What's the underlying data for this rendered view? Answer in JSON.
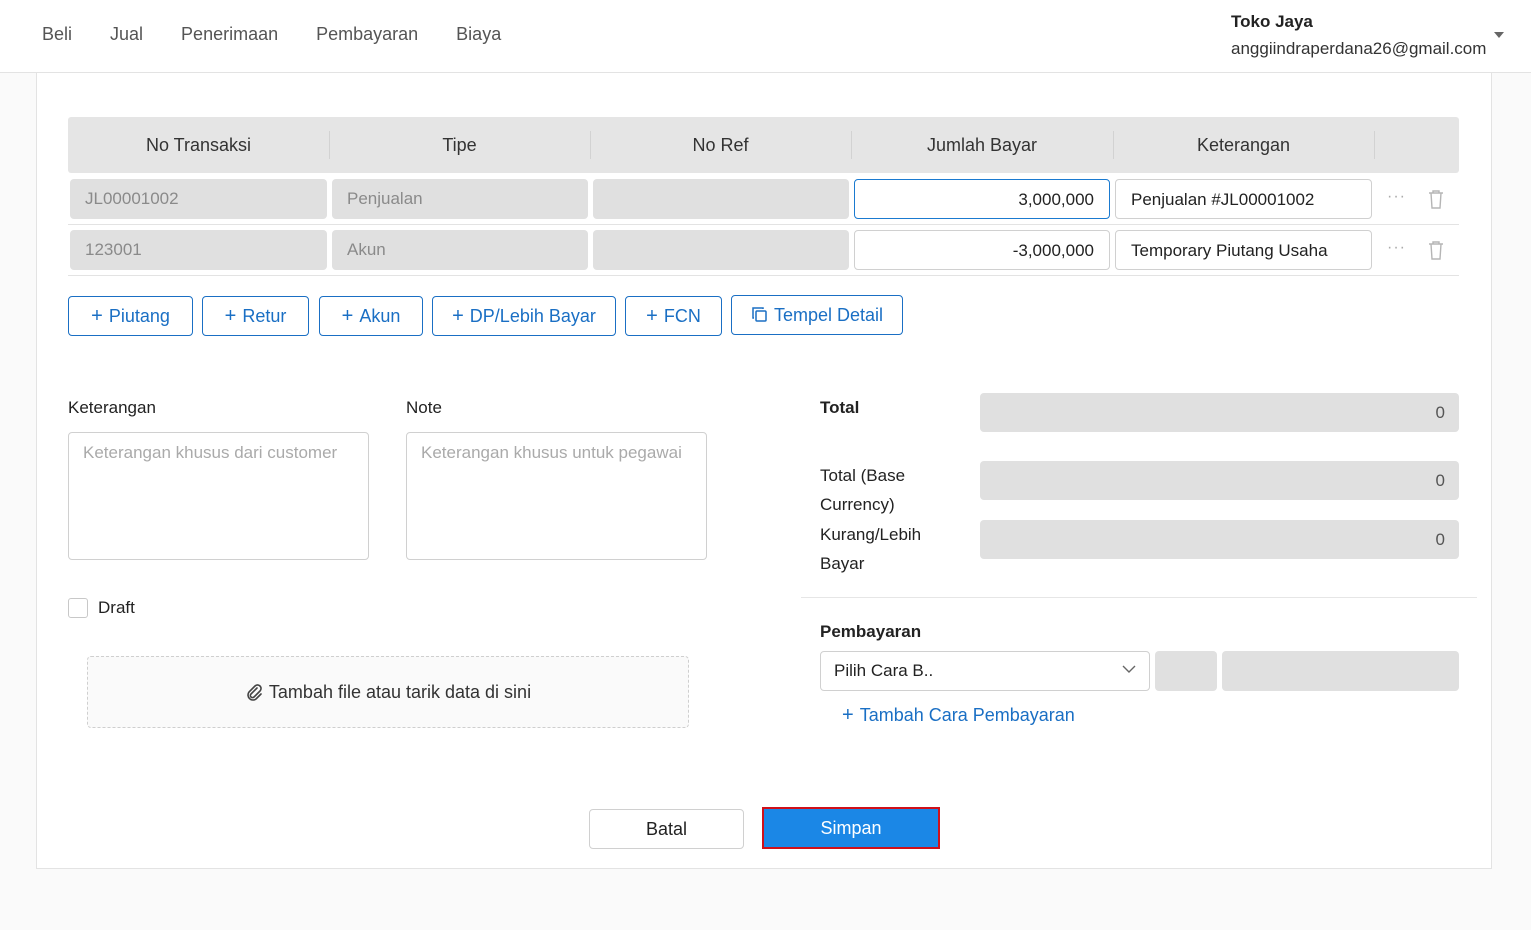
{
  "nav": [
    "Beli",
    "Jual",
    "Penerimaan",
    "Pembayaran",
    "Biaya"
  ],
  "user": {
    "company": "Toko Jaya",
    "email": "anggiindraperdana26@gmail.com"
  },
  "table": {
    "headers": [
      "No Transaksi",
      "Tipe",
      "No Ref",
      "Jumlah Bayar",
      "Keterangan"
    ],
    "rows": [
      {
        "no_transaksi": "JL00001002",
        "tipe": "Penjualan",
        "no_ref": "",
        "jumlah_bayar": "3,000,000",
        "keterangan": "Penjualan #JL00001002"
      },
      {
        "no_transaksi": "123001",
        "tipe": "Akun",
        "no_ref": "",
        "jumlah_bayar": "-3,000,000",
        "keterangan": "Temporary Piutang Usaha"
      }
    ]
  },
  "add_buttons": [
    "Piutang",
    "Retur",
    "Akun",
    "DP/Lebih Bayar",
    "FCN",
    "Tempel Detail"
  ],
  "keterangan": {
    "label": "Keterangan",
    "placeholder": "Keterangan khusus dari customer"
  },
  "note": {
    "label": "Note",
    "placeholder": "Keterangan khusus untuk pegawai"
  },
  "draft_label": "Draft",
  "dropzone_label": "Tambah file atau tarik data di sini",
  "summary": {
    "total_label": "Total",
    "total_value": "0",
    "base_label_1": "Total (Base",
    "base_label_2": "Currency)",
    "base_value": "0",
    "kurang_label_1": "Kurang/Lebih",
    "kurang_label_2": "Bayar",
    "kurang_value": "0"
  },
  "payment": {
    "label": "Pembayaran",
    "select_value": "Pilih Cara B..",
    "add_label": "Tambah Cara Pembayaran"
  },
  "actions": {
    "cancel": "Batal",
    "save": "Simpan"
  },
  "colors": {
    "primary": "#1a6fc4",
    "save_bg": "#1b87e6",
    "highlight_border": "#d0101a"
  }
}
